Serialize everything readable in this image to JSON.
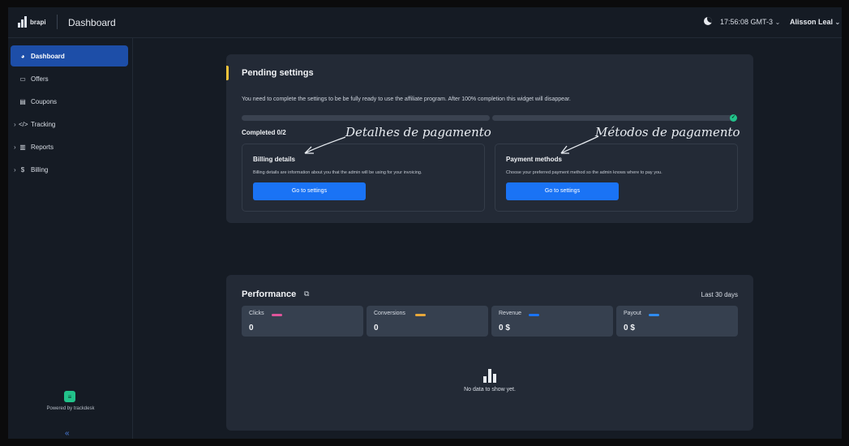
{
  "app": {
    "logo": "brapi",
    "title": "Dashboard"
  },
  "header": {
    "time": "17:56:08 GMT-3",
    "user": "Alisson Leal"
  },
  "sidebar": {
    "items": [
      {
        "label": "Dashboard",
        "icon": "pie-chart-icon",
        "active": true
      },
      {
        "label": "Offers",
        "icon": "offer-card-icon"
      },
      {
        "label": "Coupons",
        "icon": "coupon-icon"
      },
      {
        "label": "Tracking",
        "icon": "code-icon"
      },
      {
        "label": "Reports",
        "icon": "reports-icon"
      },
      {
        "label": "Billing",
        "icon": "dollar-icon"
      }
    ],
    "powered": "Powered by trackdesk"
  },
  "pending": {
    "title": "Pending settings",
    "desc": "You need to complete the settings to be be fully ready to use the affiliate program. After 100% completion this widget will disappear.",
    "completed": "Completed 0/2",
    "billing": {
      "title": "Billing details",
      "desc": "Billing details are information about you that the admin will be using for your invoicing.",
      "button": "Go to settings"
    },
    "payment": {
      "title": "Payment methods",
      "desc": "Choose your preferred payment method so the admin knows where to pay you.",
      "button": "Go to settings"
    }
  },
  "annotations": {
    "billing": "Detalhes de pagamento",
    "payment": "Métodos de pagamento"
  },
  "performance": {
    "title": "Performance",
    "range": "Last 30 days",
    "metrics": [
      {
        "label": "Clicks",
        "value": "0",
        "color": "#e0559b"
      },
      {
        "label": "Conversions",
        "value": "0",
        "color": "#e8a83a"
      },
      {
        "label": "Revenue",
        "value": "0 $",
        "color": "#1a73f5"
      },
      {
        "label": "Payout",
        "value": "0 $",
        "color": "#2f8cf0"
      }
    ],
    "empty": "No data to show yet."
  },
  "colors": {
    "accent": "#f2c33a",
    "primary": "#1a73f5",
    "success": "#22c28a",
    "sidebar_active": "#1d4ea8"
  }
}
